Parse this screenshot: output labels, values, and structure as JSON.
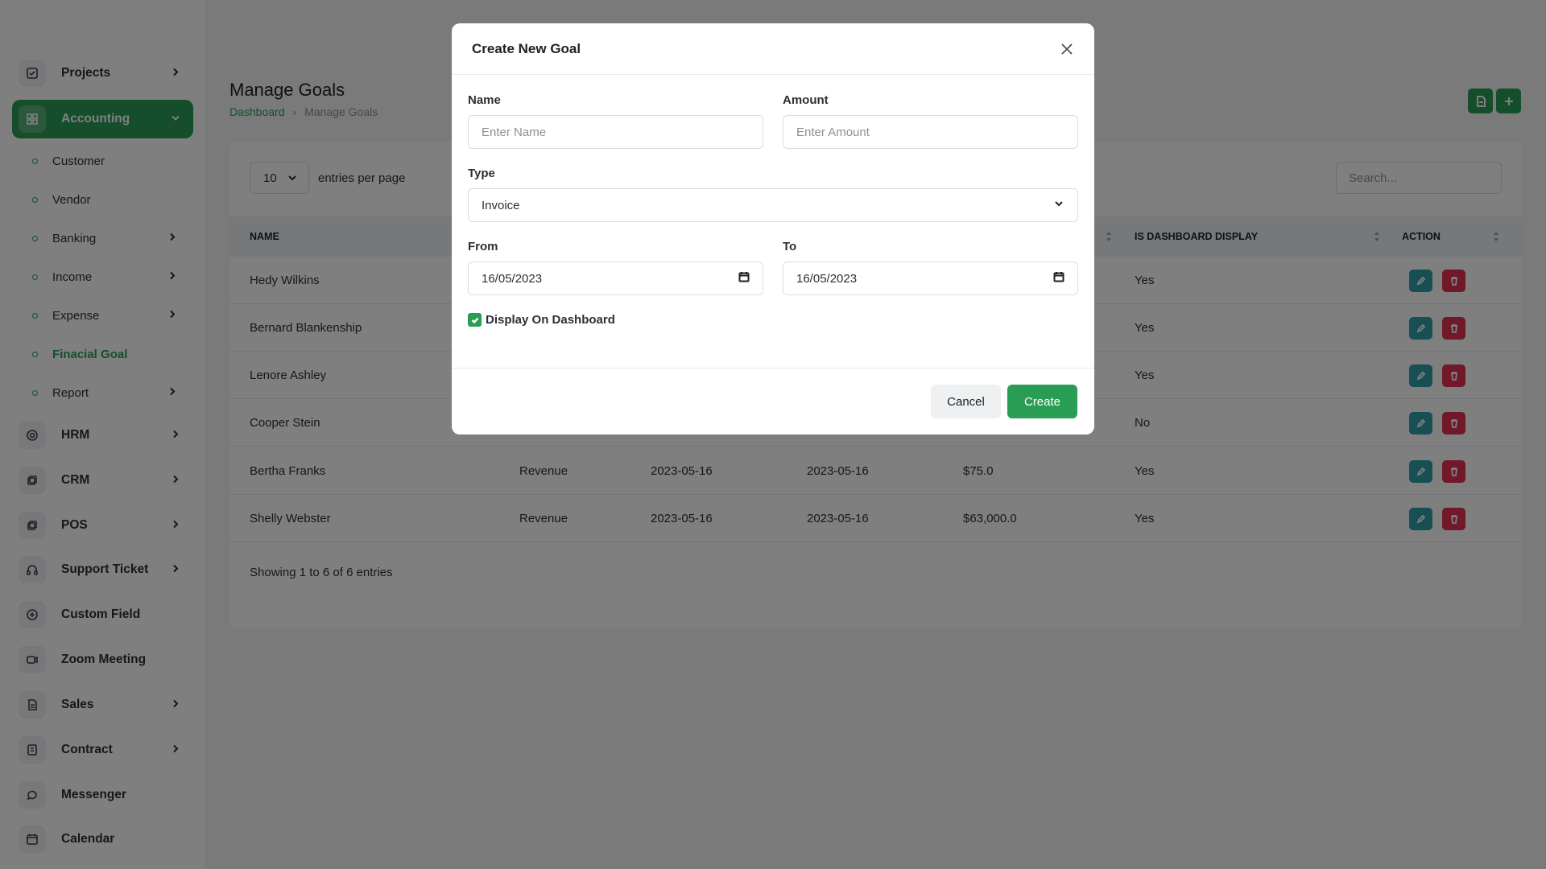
{
  "sidebar": {
    "projects": "Projects",
    "accounting": "Accounting",
    "sub": [
      "Customer",
      "Vendor",
      "Banking",
      "Income",
      "Expense",
      "Finacial Goal",
      "Report"
    ],
    "hrm": "HRM",
    "crm": "CRM",
    "pos": "POS",
    "support": "Support Ticket",
    "custom_field": "Custom Field",
    "zoom": "Zoom Meeting",
    "sales": "Sales",
    "contract": "Contract",
    "messenger": "Messenger",
    "calendar": "Calendar"
  },
  "header": {
    "title": "Manage Goals",
    "breadcrumb_home": "Dashboard",
    "breadcrumb_current": "Manage Goals"
  },
  "table": {
    "entries_value": "10",
    "entries_label": "entries per page",
    "search_placeholder": "Search...",
    "col_name": "NAME",
    "col_dashboard": "IS DASHBOARD DISPLAY",
    "col_action": "ACTION",
    "rows": [
      {
        "name": "Hedy Wilkins",
        "type": "",
        "from": "",
        "to": "",
        "amount": "",
        "display": "Yes"
      },
      {
        "name": "Bernard Blankenship",
        "type": "",
        "from": "",
        "to": "",
        "amount": "",
        "display": "Yes"
      },
      {
        "name": "Lenore Ashley",
        "type": "",
        "from": "",
        "to": "",
        "amount": "",
        "display": "Yes"
      },
      {
        "name": "Cooper Stein",
        "type": "",
        "from": "",
        "to": "",
        "amount": "",
        "display": "No"
      },
      {
        "name": "Bertha Franks",
        "type": "Revenue",
        "from": "2023-05-16",
        "to": "2023-05-16",
        "amount": "$75.0",
        "display": "Yes"
      },
      {
        "name": "Shelly Webster",
        "type": "Revenue",
        "from": "2023-05-16",
        "to": "2023-05-16",
        "amount": "$63,000.0",
        "display": "Yes"
      }
    ],
    "showing": "Showing 1 to 6 of 6 entries"
  },
  "modal": {
    "title": "Create New Goal",
    "name_label": "Name",
    "name_placeholder": "Enter Name",
    "amount_label": "Amount",
    "amount_placeholder": "Enter Amount",
    "type_label": "Type",
    "type_value": "Invoice",
    "from_label": "From",
    "from_value": "16/05/2023",
    "to_label": "To",
    "to_value": "16/05/2023",
    "display_label": "Display On Dashboard",
    "display_checked": true,
    "cancel": "Cancel",
    "create": "Create"
  },
  "colors": {
    "primary": "#2a9d55",
    "edit": "#2fa0a8",
    "delete": "#e03353",
    "overlay": "rgba(0,0,0,0.5)"
  }
}
